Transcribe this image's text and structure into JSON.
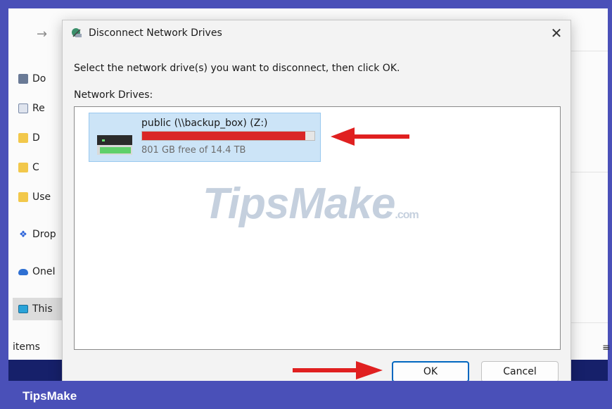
{
  "dialog": {
    "title": "Disconnect Network Drives",
    "instruction": "Select the network drive(s) you want to disconnect, then click OK.",
    "list_label": "Network Drives:",
    "close_glyph": "✕",
    "drives": [
      {
        "name": "public (\\\\backup_box) (Z:)",
        "free_text": "801 GB free of 14.4 TB",
        "used_fraction": 0.946
      }
    ],
    "ok_label": "OK",
    "cancel_label": "Cancel"
  },
  "explorer": {
    "nav_arrow": "→",
    "sidebar": [
      {
        "label": "Do",
        "icon": "document-icon"
      },
      {
        "label": "Re",
        "icon": "recent-icon"
      },
      {
        "label": "D",
        "icon": "folder-icon"
      },
      {
        "label": "C",
        "icon": "folder-icon"
      },
      {
        "label": "Use",
        "icon": "folder-icon"
      },
      {
        "label": "Drop",
        "icon": "dropbox-icon"
      },
      {
        "label": "OneI",
        "icon": "onedrive-icon"
      },
      {
        "label": "This",
        "icon": "this-pc-icon"
      }
    ],
    "status": "items"
  },
  "brand": "TipsMake",
  "watermark": {
    "main": "TipsMake",
    "suffix": ".com"
  },
  "colors": {
    "frame": "#4a50b8",
    "selection": "#cce4f7",
    "usage": "#da2626",
    "accent": "#0067c0",
    "annotation_arrow": "#e02020"
  }
}
